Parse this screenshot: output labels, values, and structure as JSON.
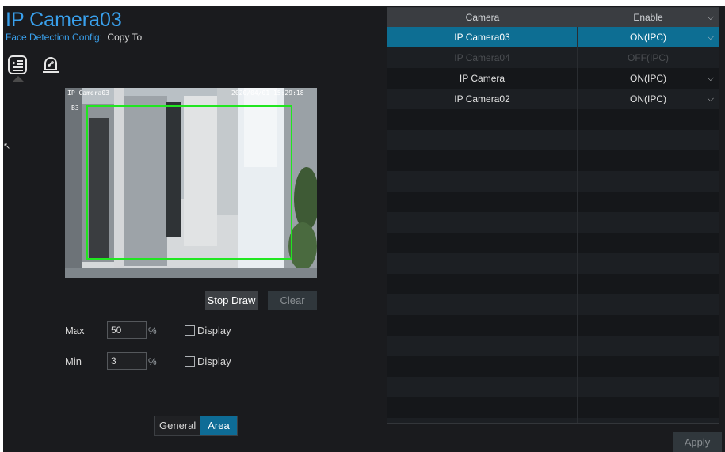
{
  "header": {
    "title": "IP Camera03",
    "subtitle_prefix": "Face Detection Config:",
    "copy_to": "Copy To"
  },
  "tabs": [
    {
      "icon": "list-settings-icon",
      "active": true
    },
    {
      "icon": "alarm-light-icon",
      "active": false
    }
  ],
  "preview": {
    "osd_name": "IP Camera03",
    "osd_time": "2020/04/01 15:29:18",
    "osd_channel": "B3"
  },
  "draw_buttons": {
    "stop_draw": "Stop Draw",
    "clear": "Clear"
  },
  "size": {
    "max_label": "Max",
    "max_value": "50",
    "min_label": "Min",
    "min_value": "3",
    "unit": "%",
    "display_label": "Display"
  },
  "mode_tabs": {
    "general": "General",
    "area": "Area",
    "selected": "Area"
  },
  "camera_table": {
    "headers": {
      "camera": "Camera",
      "enable": "Enable"
    },
    "rows": [
      {
        "camera": "IP Camera03",
        "enable": "ON(IPC)"
      },
      {
        "camera": "IP Camera04",
        "enable": "OFF(IPC)"
      },
      {
        "camera": "IP Camera",
        "enable": "ON(IPC)"
      },
      {
        "camera": "IP Camera02",
        "enable": "ON(IPC)"
      }
    ]
  },
  "apply_label": "Apply",
  "colors": {
    "accent": "#39a0ec",
    "selected_row": "#0d6e93",
    "detection_box": "#21e621"
  }
}
